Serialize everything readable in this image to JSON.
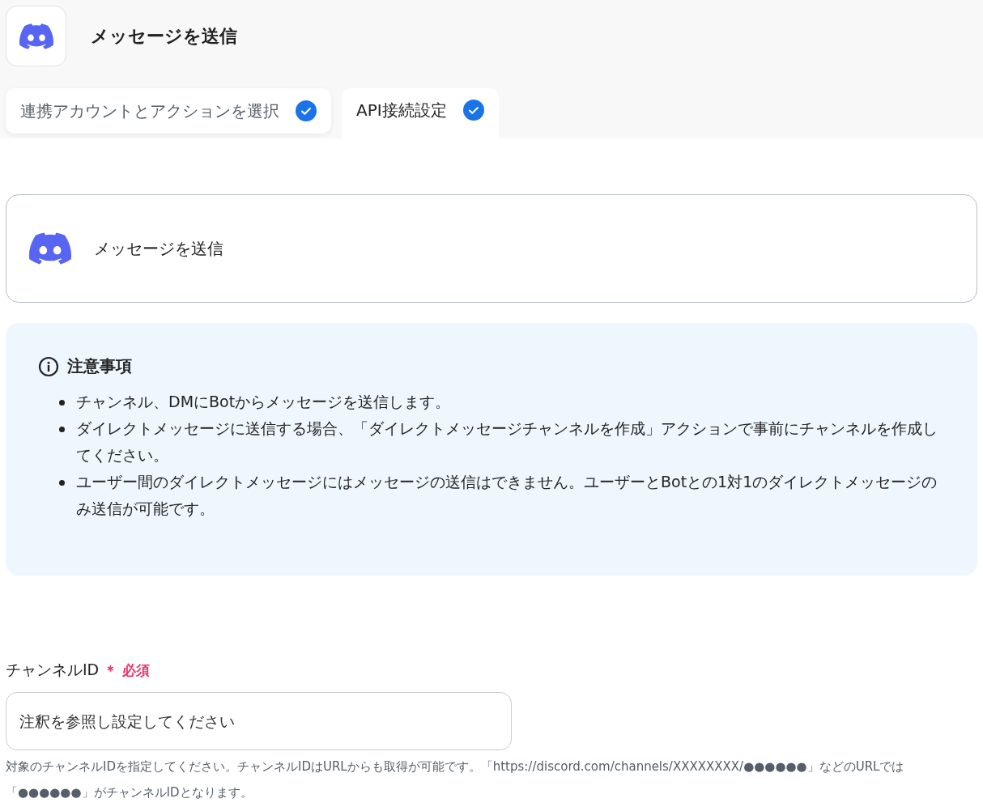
{
  "header": {
    "title": "メッセージを送信"
  },
  "tabs": [
    {
      "label": "連携アカウントとアクションを選択",
      "selected": false,
      "checked": true
    },
    {
      "label": "API接続設定",
      "selected": true,
      "checked": true
    }
  ],
  "action": {
    "label": "メッセージを送信"
  },
  "notice": {
    "title": "注意事項",
    "items": [
      "チャンネル、DMにBotからメッセージを送信します。",
      "ダイレクトメッセージに送信する場合、「ダイレクトメッセージチャンネルを作成」アクションで事前にチャンネルを作成してください。",
      "ユーザー間のダイレクトメッセージにはメッセージの送信はできません。ユーザーとBotとの1対1のダイレクトメッセージのみ送信が可能です。"
    ]
  },
  "field": {
    "label": "チャンネルID",
    "required": true,
    "required_mark": "＊",
    "required_label": "必須",
    "placeholder": "注釈を参照し設定してください",
    "help": "対象のチャンネルIDを指定してください。チャンネルIDはURLからも取得が可能です。「https://discord.com/channels/XXXXXXXX/●●●●●●」などのURLでは「●●●●●●」がチャンネルIDとなります。"
  }
}
